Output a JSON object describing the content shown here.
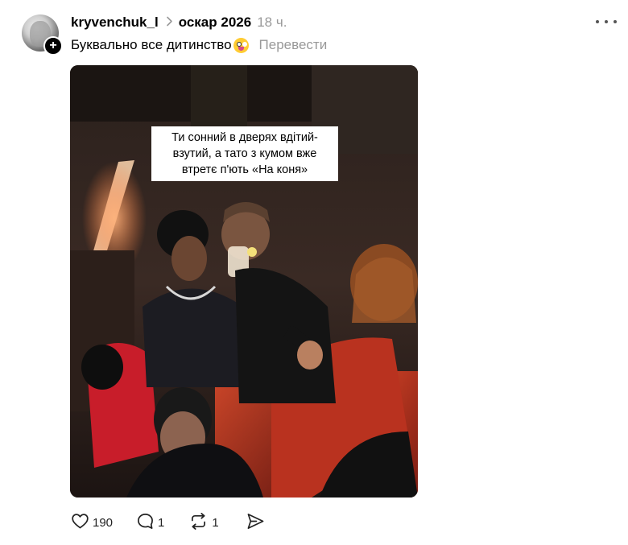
{
  "post": {
    "username": "kryvenchuk_l",
    "topic": "оскар 2026",
    "time": "18 ч.",
    "caption": "Буквально все дитинство",
    "caption_emoji": "zany-face-emoji",
    "translate_label": "Перевести",
    "media_overlay_text": "Ти сонний в дверях вдітий-взутий, а тато з кумом вже втретє п'ють «На коня»"
  },
  "actions": {
    "likes": "190",
    "comments": "1",
    "reposts": "1"
  },
  "icons": {
    "more": "more-dots-icon",
    "like": "heart-icon",
    "comment": "comment-icon",
    "repost": "repost-icon",
    "share": "send-icon",
    "follow": "plus-icon"
  }
}
